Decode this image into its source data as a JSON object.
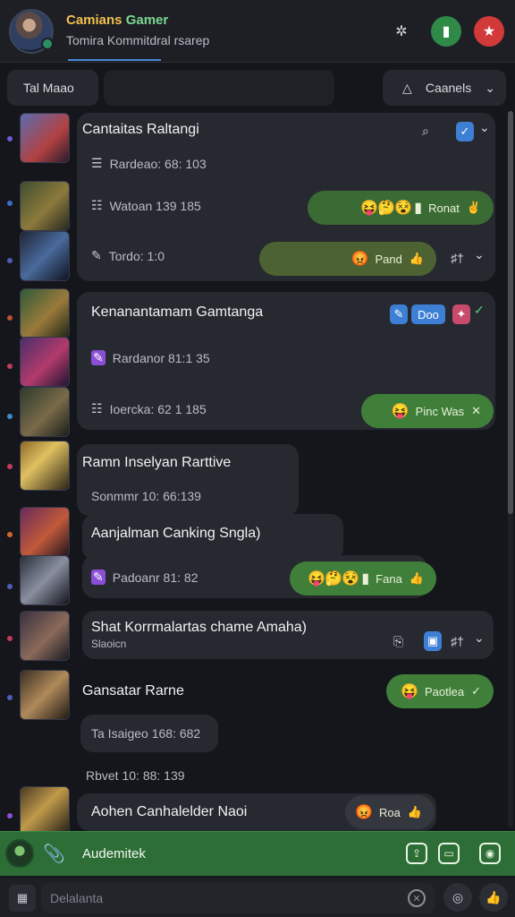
{
  "header": {
    "title_a": "Camians",
    "title_b": "Gamer",
    "subtitle": "Tomira Kommitdral rsarep"
  },
  "filters": {
    "left_label": "Tal Maao",
    "right_label": "Caanels"
  },
  "messages": [
    {
      "title": "Cantaitas Raltangi",
      "rows": [
        {
          "icon": "list-icon",
          "text": "Rardeao: 68: 103"
        },
        {
          "icon": "list-icon",
          "text": "Watoan 139 185",
          "bubble": "Ronat"
        },
        {
          "icon": "pencil-icon",
          "text": "Tordo: 1:0",
          "bubble": "Pand"
        }
      ]
    },
    {
      "title": "Kenanantamam Gamtanga",
      "tag": "Doo",
      "rows": [
        {
          "icon": "pencil-icon",
          "text": "Rardanor 81:1 35"
        },
        {
          "icon": "list-icon",
          "text": "Ioercka: 62 1 185",
          "bubble": "Pinc Was"
        }
      ]
    },
    {
      "title": "Ramn Inselyan Rarttive",
      "sub": "Sonmmr 10: 66:139"
    },
    {
      "title": "Aanjalman Canking Sngla)",
      "rows": [
        {
          "icon": "pencil-icon",
          "text": "Padoanr 81: 82",
          "bubble": "Fana"
        }
      ]
    },
    {
      "title": "Shat Korrmalartas chame Amaha)",
      "sub": "Slaoicn"
    },
    {
      "title": "Gansatar Rarne",
      "bubble": "Paotlea",
      "sub": "Ta Isaigeo 168: 682",
      "time": "Rbvet 10: 88: 139"
    },
    {
      "title": "Aohen Canhalelder Naoi",
      "bubble": "Roa"
    }
  ],
  "composer": {
    "text": "Audemitek"
  },
  "search": {
    "placeholder": "Delalanta"
  },
  "colors": {
    "accent_green": "#3b6b34",
    "accent_blue": "#3e7fd6",
    "title_yellow": "#f2c14e",
    "title_green": "#7bd88f"
  }
}
